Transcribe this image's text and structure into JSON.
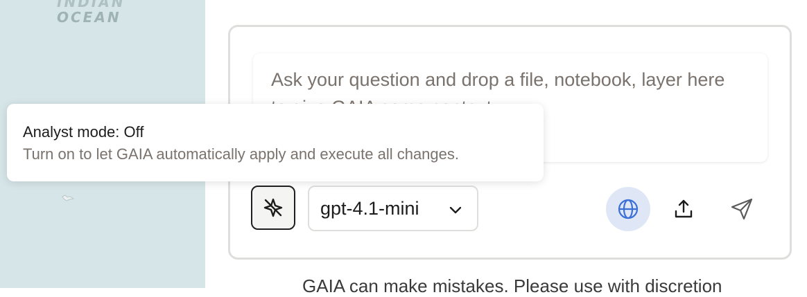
{
  "map": {
    "ocean_label_line1": "INDIAN",
    "ocean_label_line2": "OCEAN"
  },
  "composer": {
    "placeholder": "Ask your question and drop a file, notebook, layer here to give GAIA some context",
    "analyst_mode_icon": "sparkle-off-icon",
    "model": {
      "selected": "gpt-4.1-mini",
      "icon": "chevron-down-icon"
    },
    "actions": {
      "web_search_icon": "globe-icon",
      "upload_icon": "upload-icon",
      "send_icon": "send-icon"
    },
    "colors": {
      "globe_active_bg": "#dfe7f7",
      "globe_stroke": "#3b6fd6"
    }
  },
  "tooltip": {
    "title": "Analyst mode: Off",
    "description": "Turn on to let GAIA automatically apply and execute all changes."
  },
  "footer": {
    "text": "GAIA can make mistakes. Please use with discretion"
  }
}
